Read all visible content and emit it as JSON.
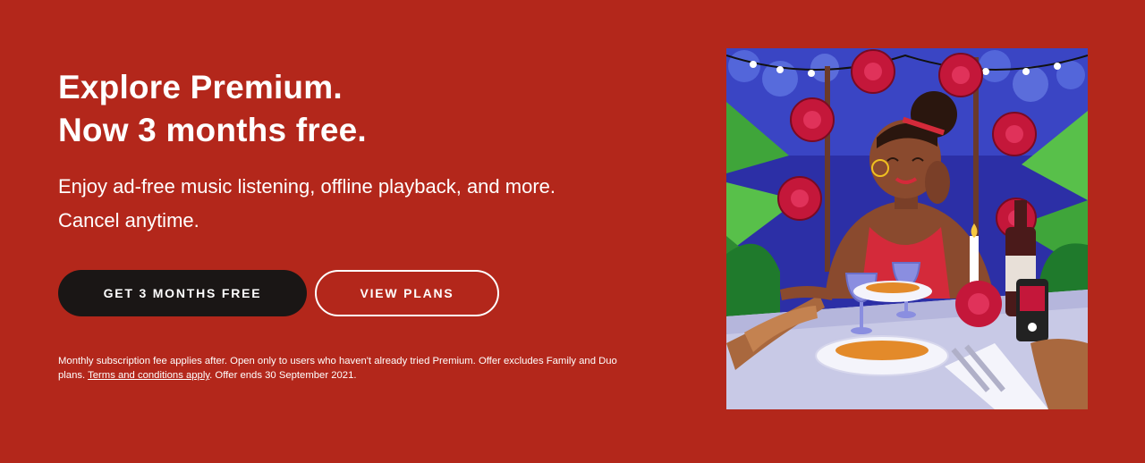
{
  "hero": {
    "headline_line1": "Explore Premium.",
    "headline_line2": "Now 3 months free.",
    "subline_line1": "Enjoy ad-free music listening, offline playback, and more.",
    "subline_line2": "Cancel anytime.",
    "primary_button": "GET 3 MONTHS FREE",
    "secondary_button": "VIEW PLANS",
    "fineprint_before": "Monthly subscription fee applies after. Open only to users who haven't already tried Premium. Offer excludes Family and Duo plans. ",
    "fineprint_link": "Terms and conditions apply",
    "fineprint_after": ". Offer ends 30 September 2021.",
    "background_color": "#b3271b",
    "primary_button_color": "#1a1615"
  },
  "illustration": {
    "subject": "woman-at-candlelit-dinner-table",
    "accent_colors": [
      "#2a2fa8",
      "#c4173a",
      "#3fa53a",
      "#c8c9e6"
    ]
  }
}
